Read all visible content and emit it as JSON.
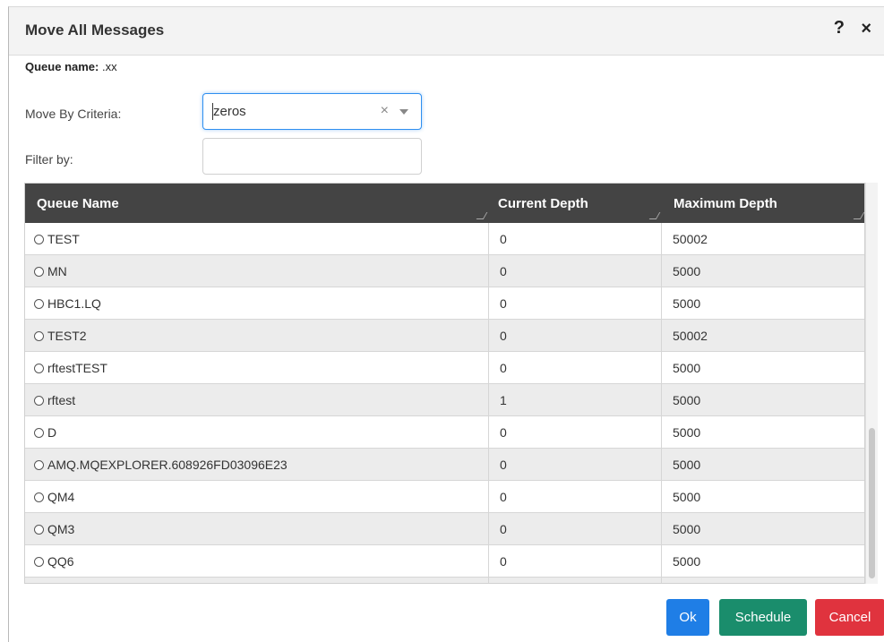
{
  "dialog": {
    "title": "Move All Messages",
    "help_icon": "?",
    "close_icon": "×"
  },
  "queue": {
    "label": "Queue name:",
    "value": ".xx"
  },
  "form": {
    "criteria_label": "Move By Criteria:",
    "criteria_value": "zeros",
    "clear_symbol": "×",
    "filter_label": "Filter by:",
    "filter_value": ""
  },
  "table": {
    "columns": [
      "Queue Name",
      "Current Depth",
      "Maximum Depth"
    ],
    "rows": [
      {
        "name": "TEST",
        "current": "0",
        "max": "50002"
      },
      {
        "name": "MN",
        "current": "0",
        "max": "5000"
      },
      {
        "name": "HBC1.LQ",
        "current": "0",
        "max": "5000"
      },
      {
        "name": "TEST2",
        "current": "0",
        "max": "50002"
      },
      {
        "name": "rftestTEST",
        "current": "0",
        "max": "5000"
      },
      {
        "name": "rftest",
        "current": "1",
        "max": "5000"
      },
      {
        "name": "D",
        "current": "0",
        "max": "5000"
      },
      {
        "name": "AMQ.MQEXPLORER.608926FD03096E23",
        "current": "0",
        "max": "5000"
      },
      {
        "name": "QM4",
        "current": "0",
        "max": "5000"
      },
      {
        "name": "QM3",
        "current": "0",
        "max": "5000"
      },
      {
        "name": "QQ6",
        "current": "0",
        "max": "5000"
      }
    ]
  },
  "buttons": {
    "ok": "Ok",
    "schedule": "Schedule",
    "cancel": "Cancel"
  },
  "colors": {
    "header_bg": "#444444",
    "ok": "#1f7ee6",
    "schedule": "#1a8d6c",
    "cancel": "#e0333e",
    "focus_border": "#2f8ff0"
  },
  "icons": [
    "help-icon",
    "close-icon",
    "clear-icon",
    "chevron-down-icon",
    "radio-icon"
  ]
}
